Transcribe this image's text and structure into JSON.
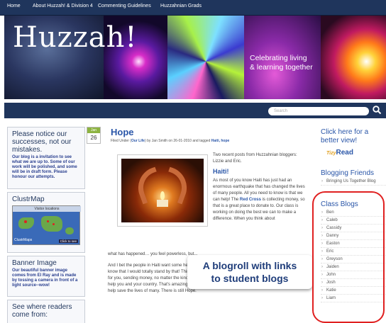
{
  "nav": {
    "items": [
      "Home",
      "About Huzzah! & Division 4",
      "Commenting Guidelines",
      "Huzzahnian Grads"
    ]
  },
  "banner": {
    "title": "Huzzah!",
    "tagline_1": "Celebrating living",
    "tagline_2": "& learning together"
  },
  "search": {
    "placeholder": "Search"
  },
  "left": {
    "notice": {
      "title": "Please notice our successes, not our mistakes.",
      "body": "Our blog is a invitation to see what we are up to. Some of our work will be polished, and some will be in draft form. Please honour our attempts."
    },
    "clustrmap": {
      "title": "ClustrMap",
      "inner_label": "Visitor locations",
      "logo": "ClustrMaps",
      "click": "Click to see"
    },
    "banner_image": {
      "title": "Banner Image",
      "body": "Our beautiful banner image comes from El Ray and is made by tossing a camera in front of a light source--wow!"
    },
    "readers": {
      "title": "See where readers come from:"
    }
  },
  "post": {
    "date_month": "Jan",
    "date_day": "26",
    "title": "Hope",
    "meta_prefix": "Filed Under (",
    "meta_category": "Our Life",
    "meta_mid": ") by Jan Smith on 26-01-2010 and tagged",
    "meta_tags": "Haiti, hope",
    "intro": "Two recent posts from Huzzahnian bloggers: Lizzie and Eric.",
    "heading": "Haiti!",
    "para_1": "As most of you know Haiti has just had an enormous earthquake that has changed the lives of many people. All you need to know is that we can help! The",
    "link_red_cross": "Red Cross",
    "para_1b": "is collecting money, so that is a great place to donate to. Our class is working on doing the best we can to make a difference. When you think about",
    "para_2": "what has happened… you feel powerless, but...",
    "para_3": "And I bet the people in Haiti want some help, because the earthquake has happened where they live. I know that I would totally stand by that! Think, if you go through something, who cares about you, praying for you, sending money, no matter the kind help you didn't even know existed are now sending money to help you and your country. That's amazing and it is all happening! You can be one of those people who can help save the lives of many. There is still Hope."
  },
  "callout": {
    "line_1": "A blogroll with links",
    "line_2": "to student blogs"
  },
  "right": {
    "better_view": "Click here for a better view!",
    "tizy_1": "Tizy",
    "tizy_2": "Read",
    "friends_title": "Blogging Friends",
    "friends_item": "Bringing Us Together Blog",
    "class_title": "Class Blogs",
    "class_blogs": [
      "Ben",
      "Caleb",
      "Cassidy",
      "Danny",
      "Easton",
      "Eric",
      "Greyson",
      "Jaiden",
      "John",
      "Josh",
      "Katie",
      "Liam"
    ]
  },
  "colors": {
    "navy": "#1f355c",
    "accent_blue": "#2a56a8",
    "highlight_red": "#e02020"
  }
}
